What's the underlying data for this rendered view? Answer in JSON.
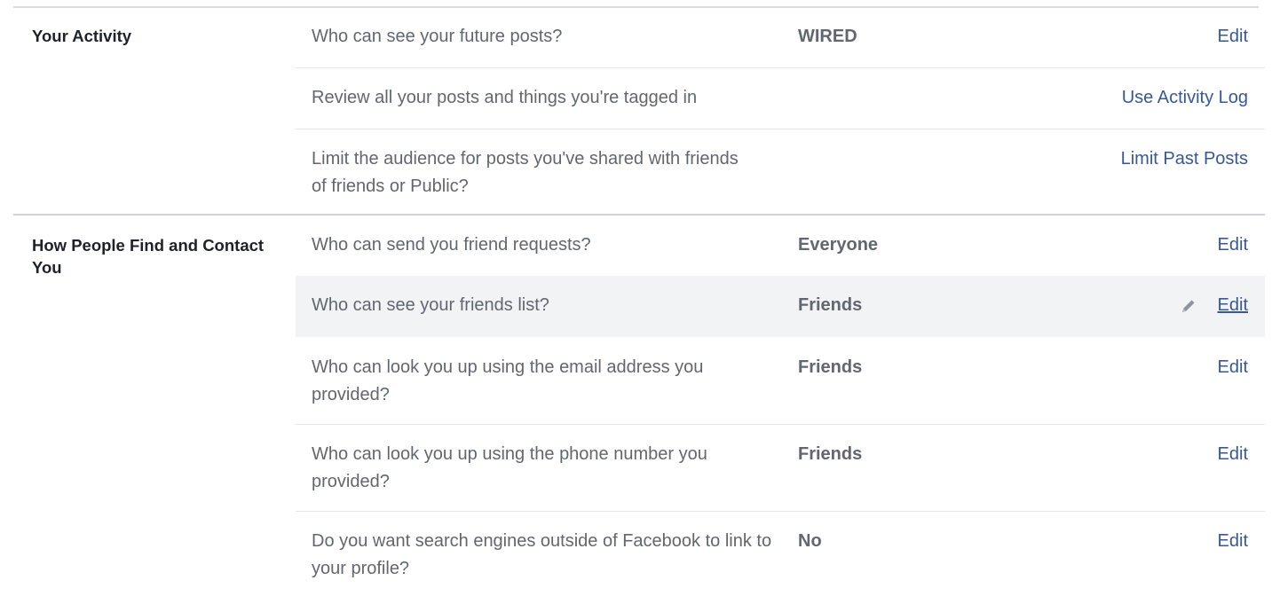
{
  "sections": [
    {
      "title": "Your Activity",
      "rows": [
        {
          "question": "Who can see your future posts?",
          "value": "WIRED",
          "action": "Edit"
        },
        {
          "question": "Review all your posts and things you're tagged in",
          "value": "",
          "action": "Use Activity Log"
        },
        {
          "question": "Limit the audience for posts you've shared with friends of friends or Public?",
          "value": "",
          "action": "Limit Past Posts"
        }
      ]
    },
    {
      "title": "How People Find and Contact You",
      "rows": [
        {
          "question": "Who can send you friend requests?",
          "value": "Everyone",
          "action": "Edit"
        },
        {
          "question": "Who can see your friends list?",
          "value": "Friends",
          "action": "Edit",
          "icon": "pencil-icon"
        },
        {
          "question": "Who can look you up using the email address you provided?",
          "value": "Friends",
          "action": "Edit"
        },
        {
          "question": "Who can look you up using the phone number you provided?",
          "value": "Friends",
          "action": "Edit"
        },
        {
          "question": "Do you want search engines outside of Facebook to link to your profile?",
          "value": "No",
          "action": "Edit"
        }
      ]
    }
  ],
  "colors": {
    "link": "#365899",
    "muted_text": "#606770",
    "hover_row": "#f2f3f5",
    "divider": "#e5e6e9"
  }
}
